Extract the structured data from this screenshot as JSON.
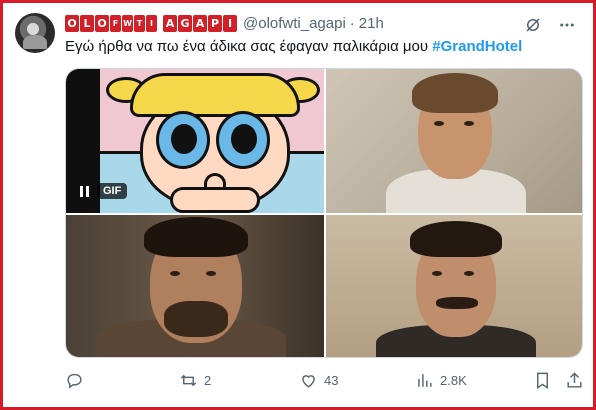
{
  "author": {
    "display_tiles": [
      "O",
      "L",
      "O",
      "F",
      "W",
      "T",
      "I",
      "A",
      "G",
      "A",
      "P",
      "I"
    ],
    "handle": "@olofwti_agapi",
    "separator": "·",
    "time": "21h"
  },
  "tweet": {
    "text": "Εγώ ήρθα να πω ένα άδικα σας έφαγαν παλικάρια μου ",
    "hashtag": "#GrandHotel"
  },
  "media": {
    "gif_badge": "GIF"
  },
  "actions": {
    "replies": "",
    "retweets": "2",
    "likes": "43",
    "views": "2.8K"
  },
  "colors": {
    "accent": "#1d9bf0",
    "muted": "#536471",
    "tile_red": "#cf2127",
    "frame_border": "#d81b2a"
  },
  "icons": [
    "grok-icon",
    "more-icon",
    "reply-icon",
    "retweet-icon",
    "like-icon",
    "views-icon",
    "bookmark-icon",
    "share-icon",
    "pause-icon"
  ]
}
